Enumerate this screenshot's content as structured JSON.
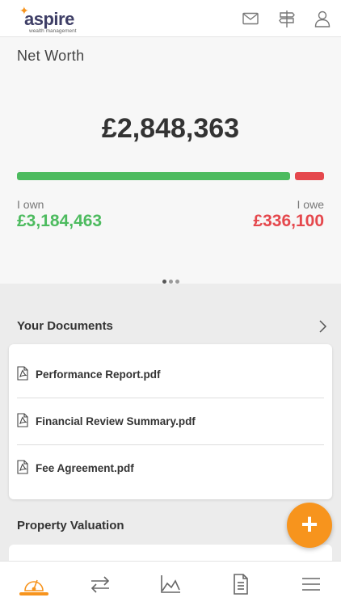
{
  "brand": {
    "name": "aspire",
    "tagline": "wealth management",
    "accent_color": "#f7941d",
    "logo_color": "#3e3e66"
  },
  "header": {
    "icons": [
      "mail-icon",
      "signpost-icon",
      "user-icon"
    ]
  },
  "net_worth": {
    "label": "Net Worth",
    "total": "£2,848,363",
    "own_label": "I own",
    "own_value": "£3,184,463",
    "owe_label": "I owe",
    "owe_value": "£336,100",
    "own_amount": 3184463,
    "owe_amount": 336100,
    "own_color": "#4dbb5f",
    "owe_color": "#e5484d",
    "pager": {
      "count": 3,
      "active_index": 0
    }
  },
  "documents": {
    "title": "Your Documents",
    "items": [
      {
        "name": "Performance Report.pdf"
      },
      {
        "name": "Financial Review Summary.pdf"
      },
      {
        "name": "Fee Agreement.pdf"
      }
    ]
  },
  "property": {
    "title": "Property Valuation"
  },
  "fab": {
    "label": "+"
  },
  "tabbar": {
    "tabs": [
      {
        "icon": "gauge-icon",
        "active": true
      },
      {
        "icon": "transfer-arrows-icon",
        "active": false
      },
      {
        "icon": "area-chart-icon",
        "active": false
      },
      {
        "icon": "document-icon",
        "active": false
      },
      {
        "icon": "menu-icon",
        "active": false
      }
    ]
  }
}
